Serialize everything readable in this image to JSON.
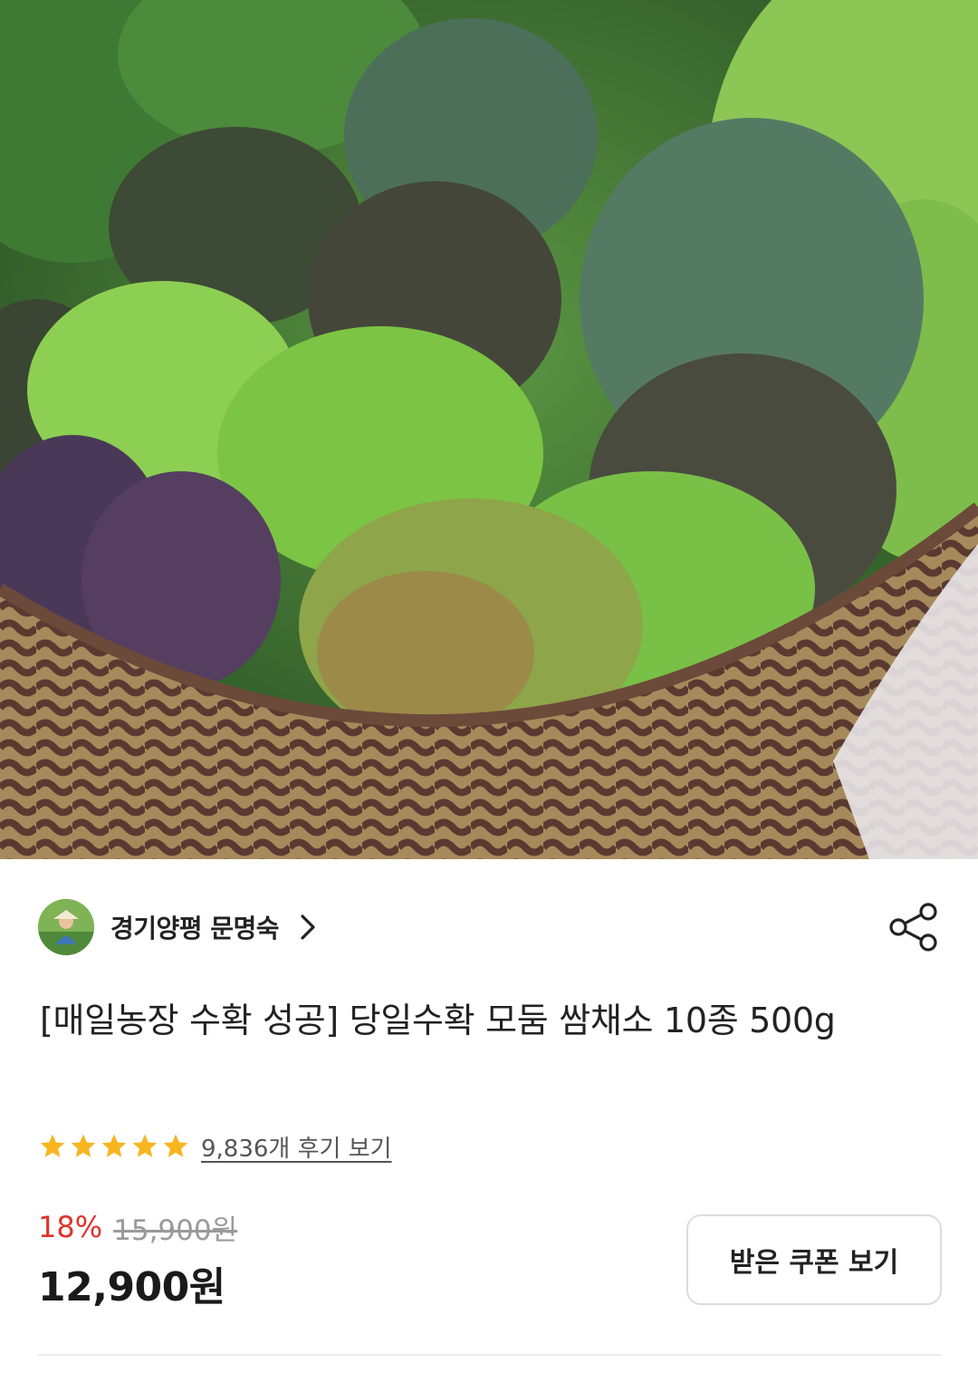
{
  "hero": {
    "icon": "vegetable-basket-photo"
  },
  "seller": {
    "name": "경기양평 문명숙",
    "avatar_icon": "farmer-avatar",
    "chevron_icon": "chevron-right-icon"
  },
  "share_icon": "share-icon",
  "product": {
    "title": "[매일농장 수확 성공] 당일수확 모둠 쌈채소 10종 500g"
  },
  "rating": {
    "stars": 5,
    "star_color": "#f7b51f",
    "reviews_text": "9,836개 후기 보기"
  },
  "price": {
    "discount": "18%",
    "original": "15,900원",
    "sale": "12,900원",
    "discount_color": "#e0322c"
  },
  "coupon_button": "받은 쿠폰 보기"
}
